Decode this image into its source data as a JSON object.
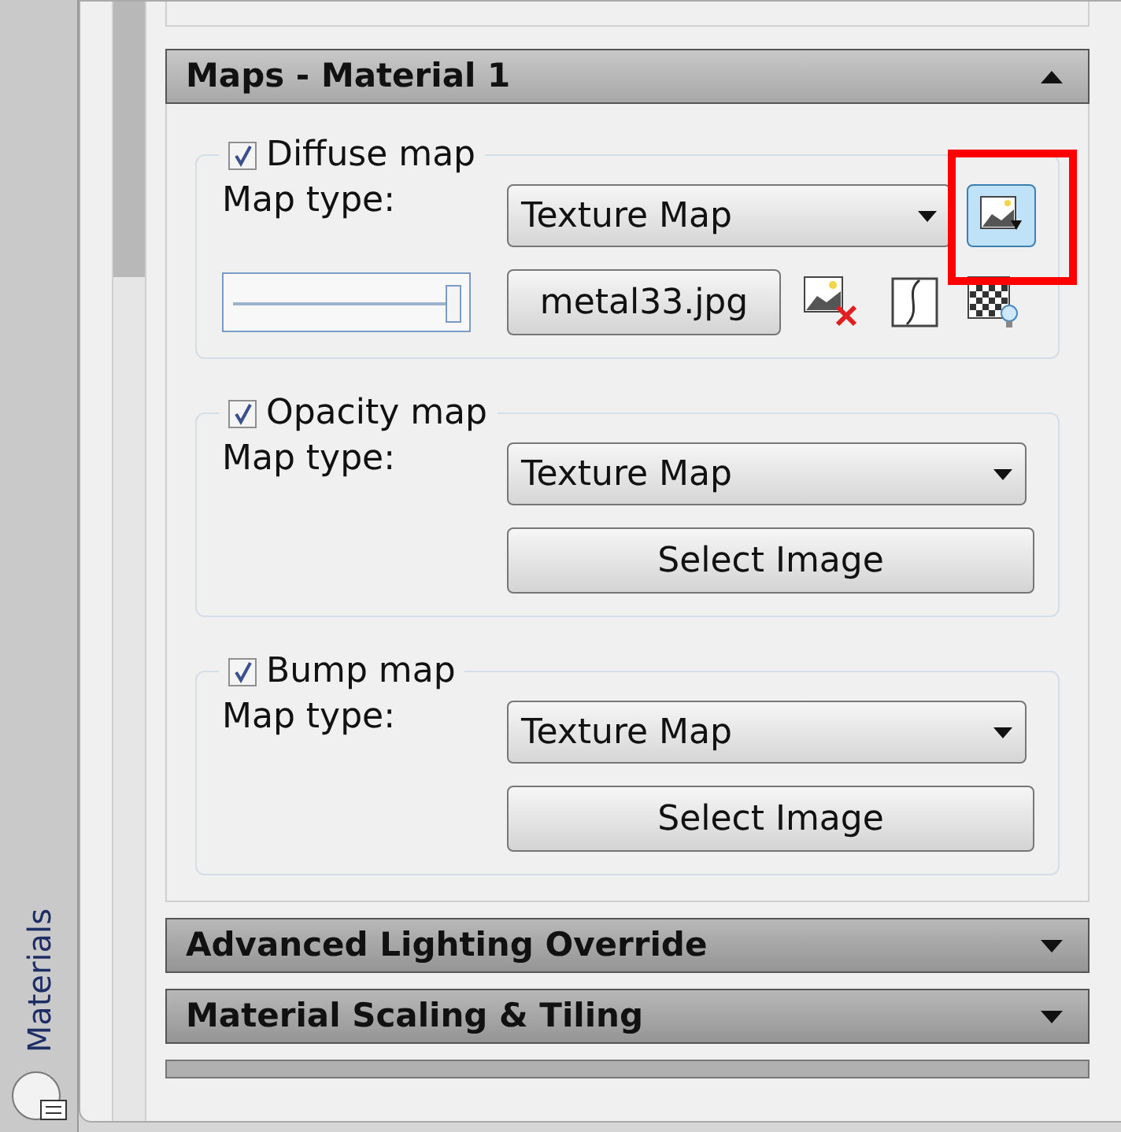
{
  "side_tab": {
    "label": "Materials"
  },
  "sections": [
    {
      "title": "Maps - Material 1",
      "expanded": true,
      "maps": [
        {
          "kind": "file",
          "label": "Diffuse map",
          "checked": true,
          "map_type_label": "Map type:",
          "map_type": "Texture Map",
          "file": "metal33.jpg",
          "level": 0.97,
          "highlighted": true
        },
        {
          "kind": "select",
          "label": "Opacity map",
          "checked": true,
          "map_type_label": "Map type:",
          "map_type": "Texture Map",
          "button": "Select Image"
        },
        {
          "kind": "select",
          "label": "Bump map",
          "checked": true,
          "map_type_label": "Map type:",
          "map_type": "Texture Map",
          "button": "Select Image"
        }
      ]
    },
    {
      "title": "Advanced Lighting Override",
      "expanded": false
    },
    {
      "title": "Material Scaling & Tiling",
      "expanded": false
    }
  ]
}
